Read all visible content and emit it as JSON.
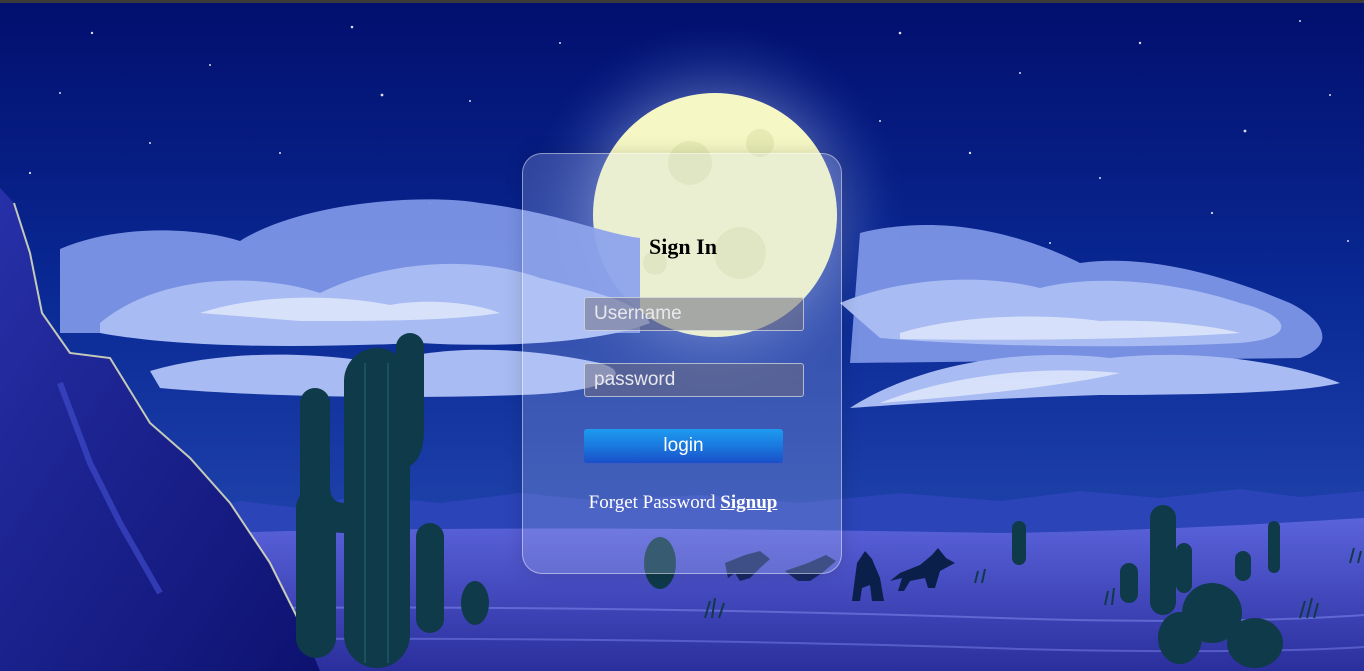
{
  "login": {
    "title": "Sign In",
    "username_placeholder": "Username",
    "password_placeholder": "password",
    "login_label": "login",
    "forget_password_label": "Forget Password",
    "signup_label": "Signup"
  },
  "colors": {
    "sky_top": "#020f6e",
    "sky_bottom": "#1d3fa8",
    "moon": "#f5f7c4",
    "cloud": "#8fa8ec",
    "ground": "#3b40b8",
    "cactus": "#103a4a",
    "button": "#1a7de0"
  }
}
